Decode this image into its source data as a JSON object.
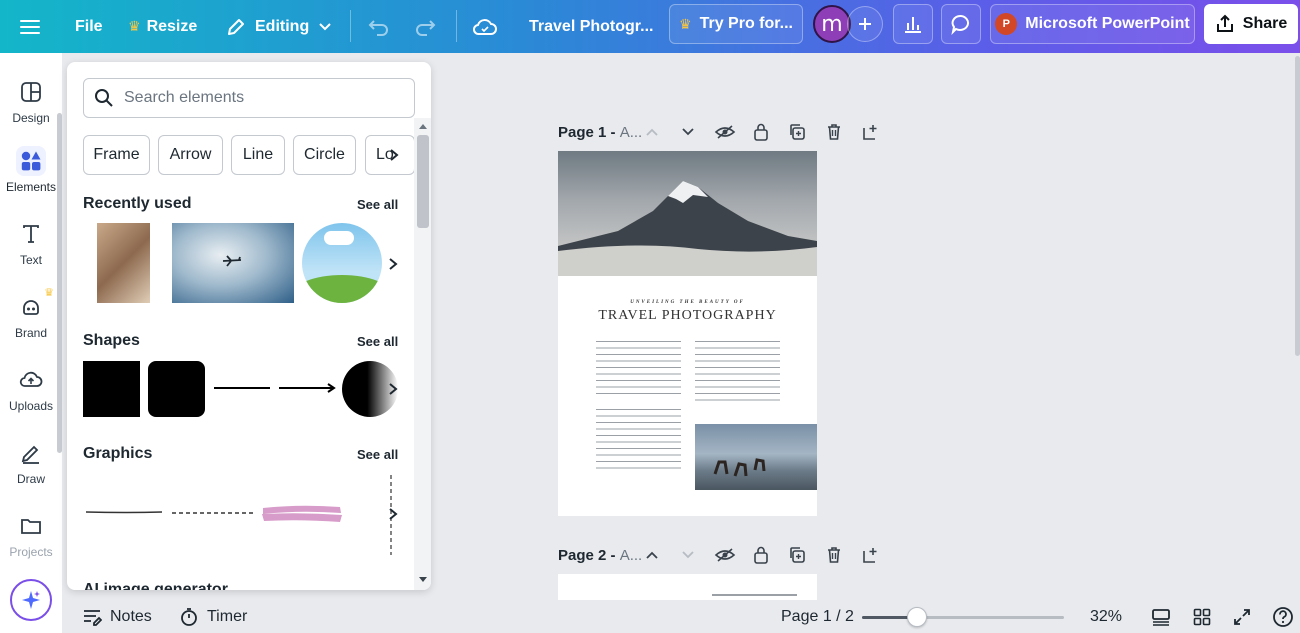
{
  "topbar": {
    "file_label": "File",
    "resize_label": "Resize",
    "editing_label": "Editing",
    "title": "Travel Photogr...",
    "try_pro_label": "Try Pro for...",
    "avatar_initial": "m",
    "powerpoint_label": "Microsoft PowerPoint",
    "share_label": "Share",
    "powerpoint_logo_letter": "P"
  },
  "rail": {
    "items": [
      {
        "label": "Design"
      },
      {
        "label": "Elements"
      },
      {
        "label": "Text"
      },
      {
        "label": "Brand"
      },
      {
        "label": "Uploads"
      },
      {
        "label": "Draw"
      },
      {
        "label": "Projects"
      }
    ]
  },
  "panel": {
    "search_placeholder": "Search elements",
    "chips": [
      "Frame",
      "Arrow",
      "Line",
      "Circle",
      "Lo"
    ],
    "recently_used": {
      "title": "Recently used",
      "see_all": "See all"
    },
    "shapes": {
      "title": "Shapes",
      "see_all": "See all"
    },
    "graphics": {
      "title": "Graphics",
      "see_all": "See all"
    },
    "ai_title": "AI image generator"
  },
  "canvas": {
    "page1": {
      "label": "Page 1 - ",
      "suffix": "A..."
    },
    "page2": {
      "label": "Page 2 - ",
      "suffix": "A..."
    },
    "doc": {
      "kicker": "UNVEILING THE BEAUTY OF",
      "heading": "TRAVEL PHOTOGRAPHY"
    }
  },
  "bottombar": {
    "notes_label": "Notes",
    "timer_label": "Timer",
    "page_indicator": "Page 1 / 2",
    "zoom_label": "32%",
    "zoom_value": 0.27
  },
  "colors": {
    "accent": "#7b4fea",
    "avatar": "#8e3fb8",
    "powerpoint": "#d24726"
  }
}
